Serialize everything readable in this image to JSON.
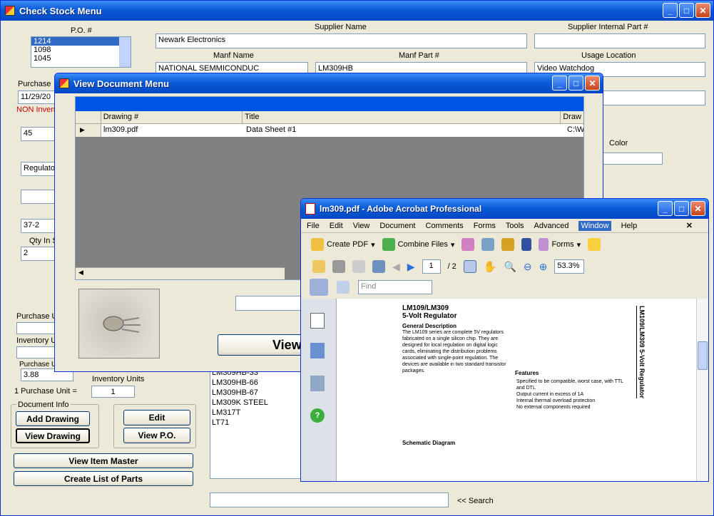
{
  "check_stock": {
    "title": "Check Stock Menu",
    "labels": {
      "po": "P.O. #",
      "supplier_name": "Supplier Name",
      "supplier_internal": "Supplier Internal Part #",
      "manf_name": "Manf Name",
      "manf_part": "Manf Part #",
      "usage_location": "Usage Location",
      "purchase_date": "Purchase",
      "non_inv": "NON Invent",
      "qty_in": "Qty In S",
      "color": "Color",
      "purchase_u": "Purchase U",
      "inventory_u": "Inventory U",
      "purchase_unit": "Purchase U",
      "inventory_units": "Inventory Units",
      "one_purchase_unit": "1 Purchase Unit =",
      "doc_info": "Document Info",
      "search": "<< Search"
    },
    "po_list": [
      "1214",
      "1098",
      "1045"
    ],
    "values": {
      "supplier_name": "Newark Electronics",
      "manf_name": "NATIONAL SEMMICONDUC",
      "manf_part": "LM309HB",
      "usage_location": "Video Watchdog",
      "purchase_date": "11/29/20",
      "f45": "45",
      "regulator": "Regulator",
      "f37": "37-2",
      "qty": "2",
      "price": "3.88",
      "units": "1",
      "search": ""
    },
    "parts": [
      "LM309HB-33",
      "LM309HB-66",
      "LM309HB-67",
      "LM309K STEEL",
      "LM317T",
      "LT71"
    ],
    "buttons": {
      "add_drawing": "Add Drawing",
      "view_drawing": "View Drawing",
      "edit": "Edit",
      "view_po": "View P.O.",
      "view_item_master": "View Item Master",
      "create_list": "Create List of Parts"
    }
  },
  "view_doc": {
    "title": "View Document Menu",
    "columns": [
      "Drawing #",
      "Title",
      "Draw"
    ],
    "row": {
      "drawing": "lm309.pdf",
      "title": "Data Sheet #1",
      "path": "C:\\W"
    },
    "view_btn": "View"
  },
  "acrobat": {
    "title": "lm309.pdf - Adobe Acrobat Professional",
    "menu": [
      "File",
      "Edit",
      "View",
      "Document",
      "Comments",
      "Forms",
      "Tools",
      "Advanced",
      "Window",
      "Help"
    ],
    "toolbar": {
      "create_pdf": "Create PDF",
      "combine": "Combine Files",
      "forms": "Forms",
      "page": "1",
      "page_total": "/ 2",
      "zoom": "53.3%",
      "find": "Find"
    },
    "doc": {
      "heading1": "LM109/LM309",
      "heading2": "5-Volt Regulator",
      "section1": "General Description",
      "features": "Features",
      "schematic": "Schematic Diagram",
      "side_title": "LM109/LM309 5-Volt Regulator",
      "para": "The LM109 series are complete 5V regulators fabricated on a single silicon chip. They are designed for local regulation on digital logic cards, eliminating the distribution problems associated with single-point regulation. The devices are available in two standard transistor packages.",
      "feat": [
        "Specified to be compatible, worst case, with TTL and DTL",
        "Output current in excess of 1A",
        "Internal thermal overload protection",
        "No external components required"
      ]
    }
  }
}
